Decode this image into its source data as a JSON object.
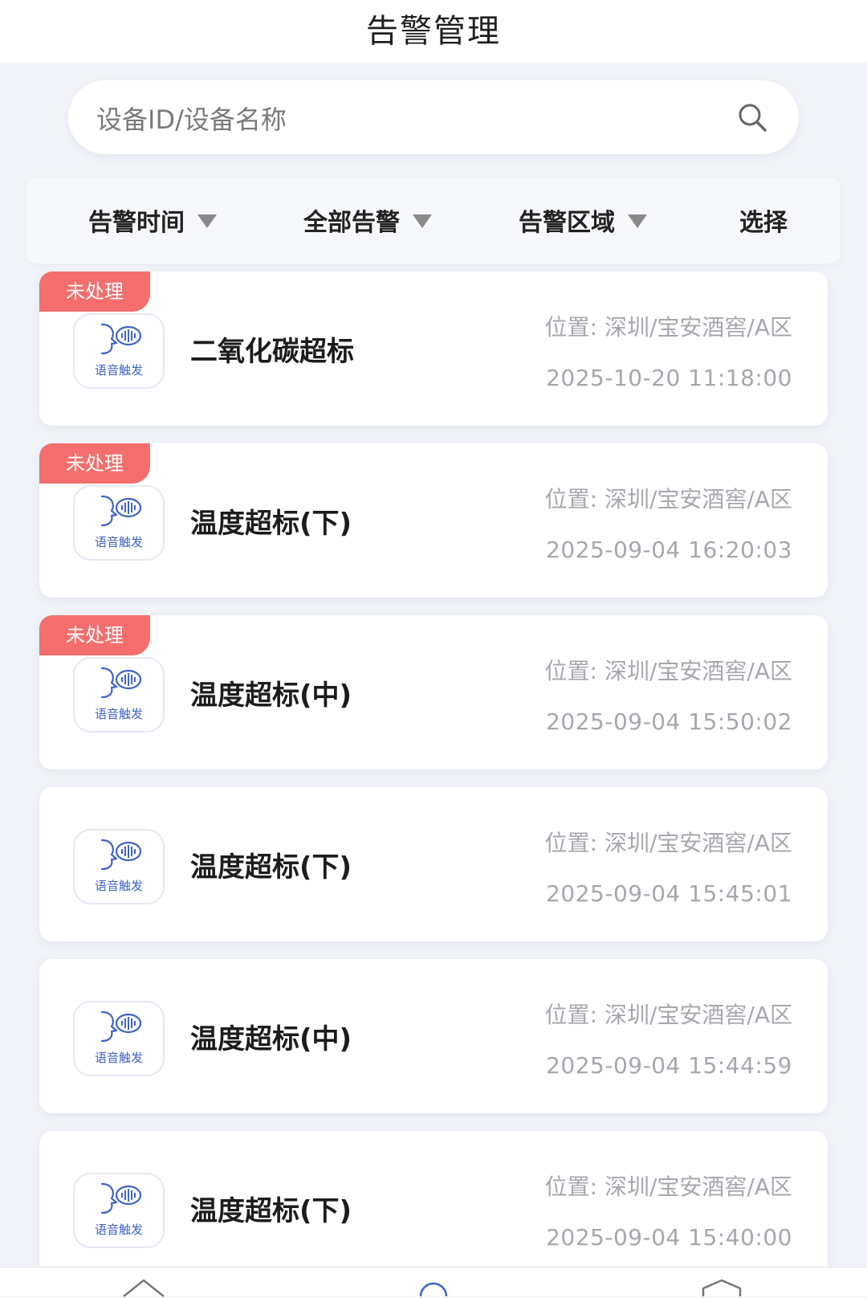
{
  "header": {
    "title": "告警管理"
  },
  "search": {
    "placeholder": "设备ID/设备名称",
    "icon": "search-icon"
  },
  "filters": [
    {
      "label": "告警时间"
    },
    {
      "label": "全部告警"
    },
    {
      "label": "告警区域"
    },
    {
      "label": "选择"
    }
  ],
  "alerts": [
    {
      "status": "未处理",
      "icon_label": "语音触发",
      "title": "二氧化碳超标",
      "location": "位置: 深圳/宝安酒窖/A区",
      "time": "2025-10-20 11:18:00"
    },
    {
      "status": "未处理",
      "icon_label": "语音触发",
      "title": "温度超标(下)",
      "location": "位置: 深圳/宝安酒窖/A区",
      "time": "2025-09-04 16:20:03"
    },
    {
      "status": "未处理",
      "icon_label": "语音触发",
      "title": "温度超标(中)",
      "location": "位置: 深圳/宝安酒窖/A区",
      "time": "2025-09-04 15:50:02"
    },
    {
      "status": "",
      "icon_label": "语音触发",
      "title": "温度超标(下)",
      "location": "位置: 深圳/宝安酒窖/A区",
      "time": "2025-09-04 15:45:01"
    },
    {
      "status": "",
      "icon_label": "语音触发",
      "title": "温度超标(中)",
      "location": "位置: 深圳/宝安酒窖/A区",
      "time": "2025-09-04 15:44:59"
    },
    {
      "status": "",
      "icon_label": "语音触发",
      "title": "温度超标(下)",
      "location": "位置: 深圳/宝安酒窖/A区",
      "time": "2025-09-04 15:40:00"
    }
  ],
  "colors": {
    "badge": "#f36e6c",
    "accent": "#3f63c9",
    "muted_text": "#a5a8ae"
  },
  "bottom_nav": [
    {
      "icon": "home-icon"
    },
    {
      "icon": "user-icon"
    },
    {
      "icon": "settings-icon"
    }
  ]
}
